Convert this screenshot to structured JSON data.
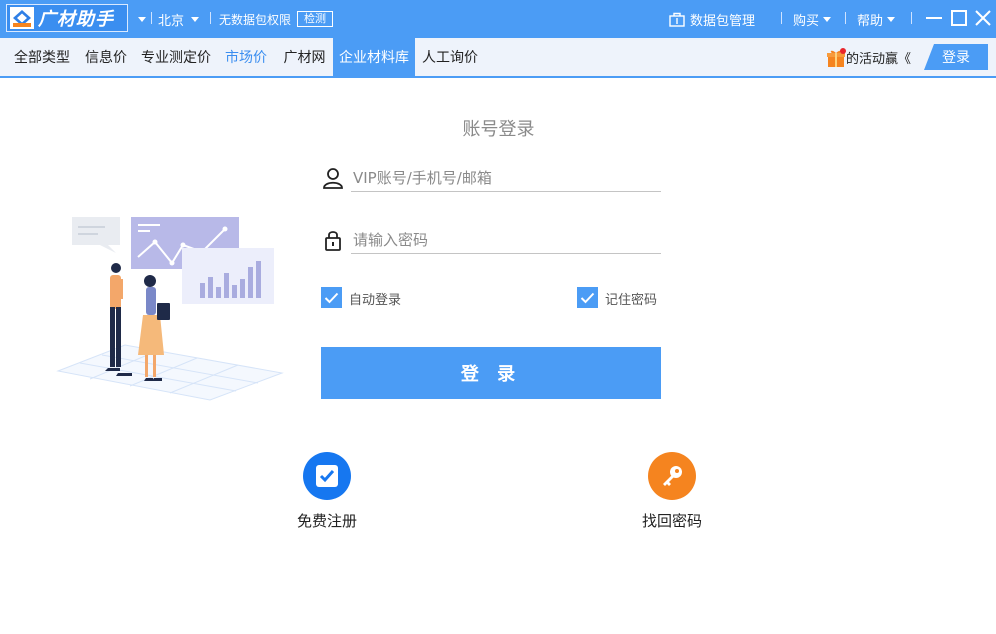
{
  "app": {
    "title": "广材助手",
    "city": "北京",
    "permission_text": "无数据包权限",
    "detect_label": "检测",
    "package_manage": "数据包管理",
    "buy": "购买",
    "help": "帮助"
  },
  "nav": {
    "tabs": [
      {
        "label": "全部类型"
      },
      {
        "label": "信息价"
      },
      {
        "label": "专业测定价"
      },
      {
        "label": "市场价"
      },
      {
        "label": "广材网"
      },
      {
        "label": "企业材料库"
      },
      {
        "label": "人工询价"
      }
    ],
    "activity": "的活动赢《",
    "login": "登录"
  },
  "login": {
    "title": "账号登录",
    "username_placeholder": "VIP账号/手机号/邮箱",
    "password_placeholder": "请输入密码",
    "auto_login": "自动登录",
    "remember_password": "记住密码",
    "auto_login_checked": true,
    "remember_checked": true,
    "submit": "登 录",
    "register": "免费注册",
    "find_password": "找回密码"
  },
  "colors": {
    "primary": "#4b9cf5",
    "register_icon_bg": "#1677f0",
    "find_icon_bg": "#f5841f"
  }
}
